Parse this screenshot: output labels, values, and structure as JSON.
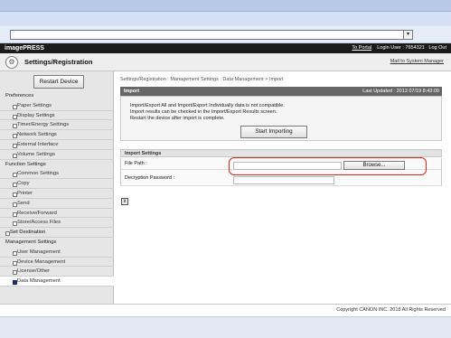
{
  "browser": {
    "address_dropdown": "▾"
  },
  "header": {
    "brand": "imagePRESS",
    "to_portal": "To Portal",
    "login_user": "Login User : 7654321",
    "logout": "Log Out"
  },
  "titlebar": {
    "title": "Settings/Registration",
    "mail_link": "Mail to System Manager",
    "icon": "settings-icon"
  },
  "sidebar": {
    "restart_label": "Restart Device",
    "items": [
      {
        "label": "Preferences",
        "kind": "hdr"
      },
      {
        "label": "Paper Settings",
        "kind": "lnk"
      },
      {
        "label": "Display Settings",
        "kind": "lnk"
      },
      {
        "label": "Timer/Energy Settings",
        "kind": "lnk"
      },
      {
        "label": "Network Settings",
        "kind": "lnk"
      },
      {
        "label": "External Interface",
        "kind": "lnk"
      },
      {
        "label": "Volume Settings",
        "kind": "lnk"
      },
      {
        "label": "Function Settings",
        "kind": "hdr"
      },
      {
        "label": "Common Settings",
        "kind": "lnk"
      },
      {
        "label": "Copy",
        "kind": "lnk"
      },
      {
        "label": "Printer",
        "kind": "lnk"
      },
      {
        "label": "Send",
        "kind": "lnk"
      },
      {
        "label": "Receive/Forward",
        "kind": "lnk"
      },
      {
        "label": "Store/Access Files",
        "kind": "lnk"
      },
      {
        "label": "Set Destination",
        "kind": "top"
      },
      {
        "label": "Management Settings",
        "kind": "hdr"
      },
      {
        "label": "User Management",
        "kind": "lnk"
      },
      {
        "label": "Device Management",
        "kind": "lnk"
      },
      {
        "label": "License/Other",
        "kind": "lnk"
      },
      {
        "label": "Data Management",
        "kind": "lnk active"
      }
    ]
  },
  "main": {
    "breadcrumb": "Settings/Registration : Management Settings : Data Management > Import",
    "import_panel": {
      "title": "Import",
      "last_updated": "Last Updated : 2013 07/19 8:43:09",
      "messages": [
        "Import/Export All and Import/Export Individually data is not compatible.",
        "Import results can be checked in the Import/Export Results screen.",
        "Restart the device after import is complete."
      ],
      "start_label": "Start Importing"
    },
    "settings": {
      "title": "Import Settings",
      "file_path_label": "File Path :",
      "browse_label": "Browse...",
      "password_label": "Decryption Password :"
    },
    "tool_icon": "x"
  },
  "footer": {
    "copyright": "Copyright CANON INC. 2018 All Rights Reserved"
  }
}
